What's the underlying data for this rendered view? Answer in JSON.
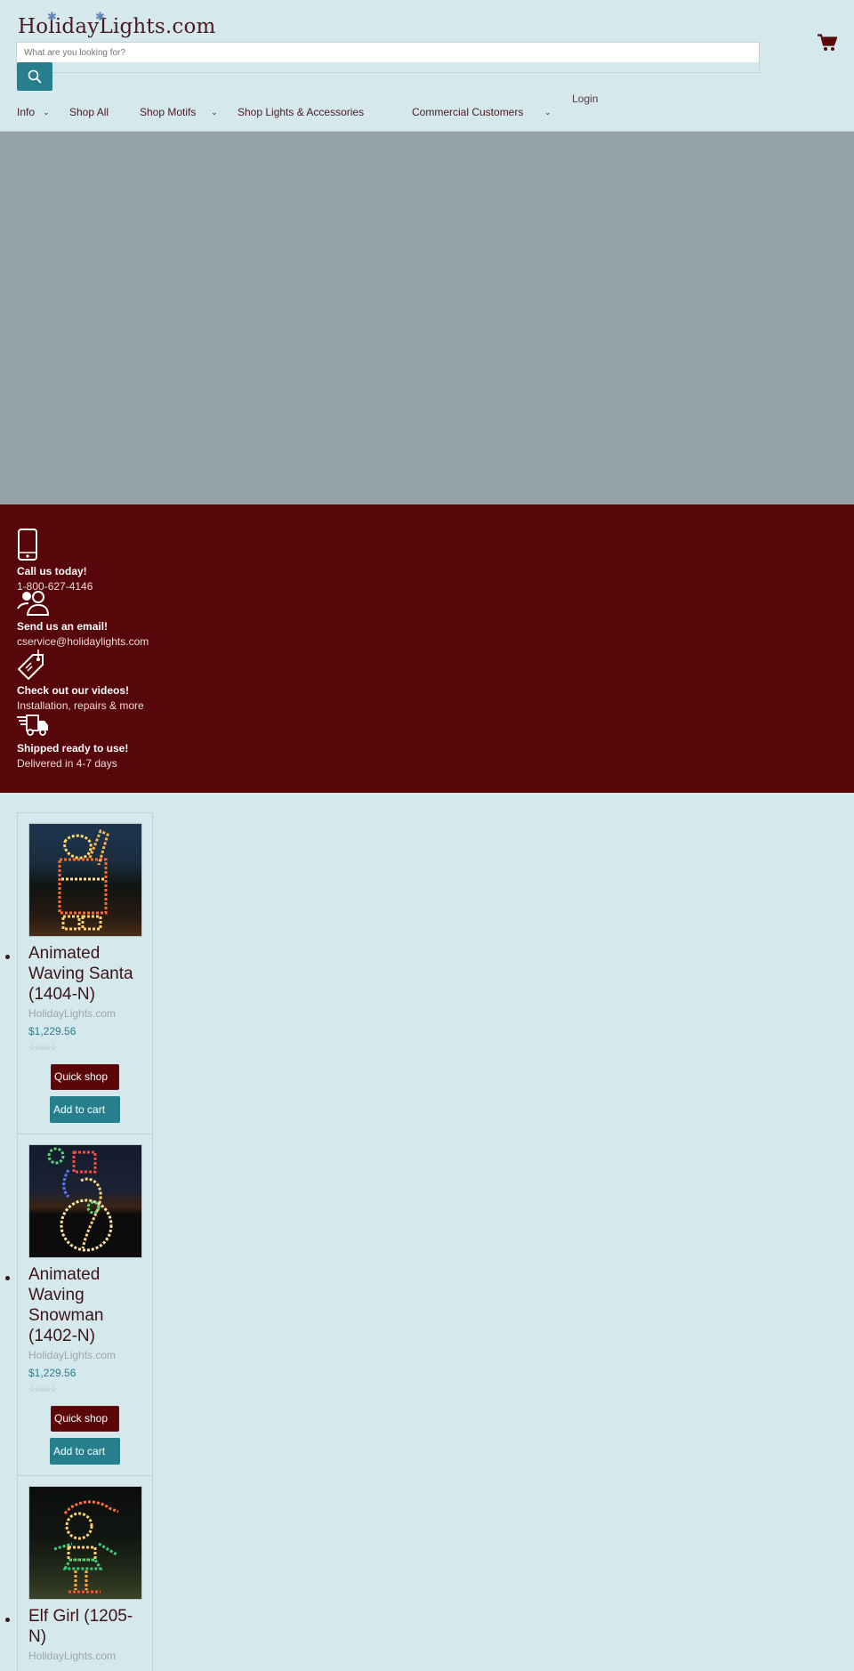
{
  "header": {
    "logo": "HolidayLights.com",
    "search_placeholder": "What are you looking for?",
    "cart_icon": "shopping-cart-icon",
    "search_icon": "search-icon"
  },
  "nav": {
    "items": [
      {
        "label": "Info",
        "has_dropdown": true
      },
      {
        "label": "Shop All",
        "has_dropdown": false
      },
      {
        "label": "Shop Motifs",
        "has_dropdown": true
      },
      {
        "label": "Shop Lights & Accessories",
        "has_dropdown": false
      },
      {
        "label": "Commercial Customers",
        "has_dropdown": true
      }
    ],
    "login": "Login"
  },
  "info": {
    "items": [
      {
        "icon": "phone-icon",
        "title": "Call us today!",
        "sub": "1-800-627-4146"
      },
      {
        "icon": "people-icon",
        "title": "Send us an email!",
        "sub": "cservice@holidaylights.com"
      },
      {
        "icon": "tag-icon",
        "title": "Check out our videos!",
        "sub": "Installation, repairs & more"
      },
      {
        "icon": "truck-icon",
        "title": "Shipped ready to use!",
        "sub": "Delivered in 4-7 days"
      }
    ]
  },
  "products": [
    {
      "title": "Animated Waving Santa (1404-N)",
      "vendor": "HolidayLights.com",
      "price": "$1,229.56",
      "rating": 0,
      "quick_shop": "Quick shop",
      "add_to_cart": "Add to cart"
    },
    {
      "title": "Animated Waving Snowman (1402-N)",
      "vendor": "HolidayLights.com",
      "price": "$1,229.56",
      "rating": 0,
      "quick_shop": "Quick shop",
      "add_to_cart": "Add to cart"
    },
    {
      "title": "Elf Girl (1205-N)",
      "vendor": "HolidayLights.com"
    }
  ],
  "colors": {
    "background": "#d5e8ec",
    "brand_maroon": "#570609",
    "accent_teal": "#277f8e",
    "hero_gray": "#95a3a8"
  }
}
